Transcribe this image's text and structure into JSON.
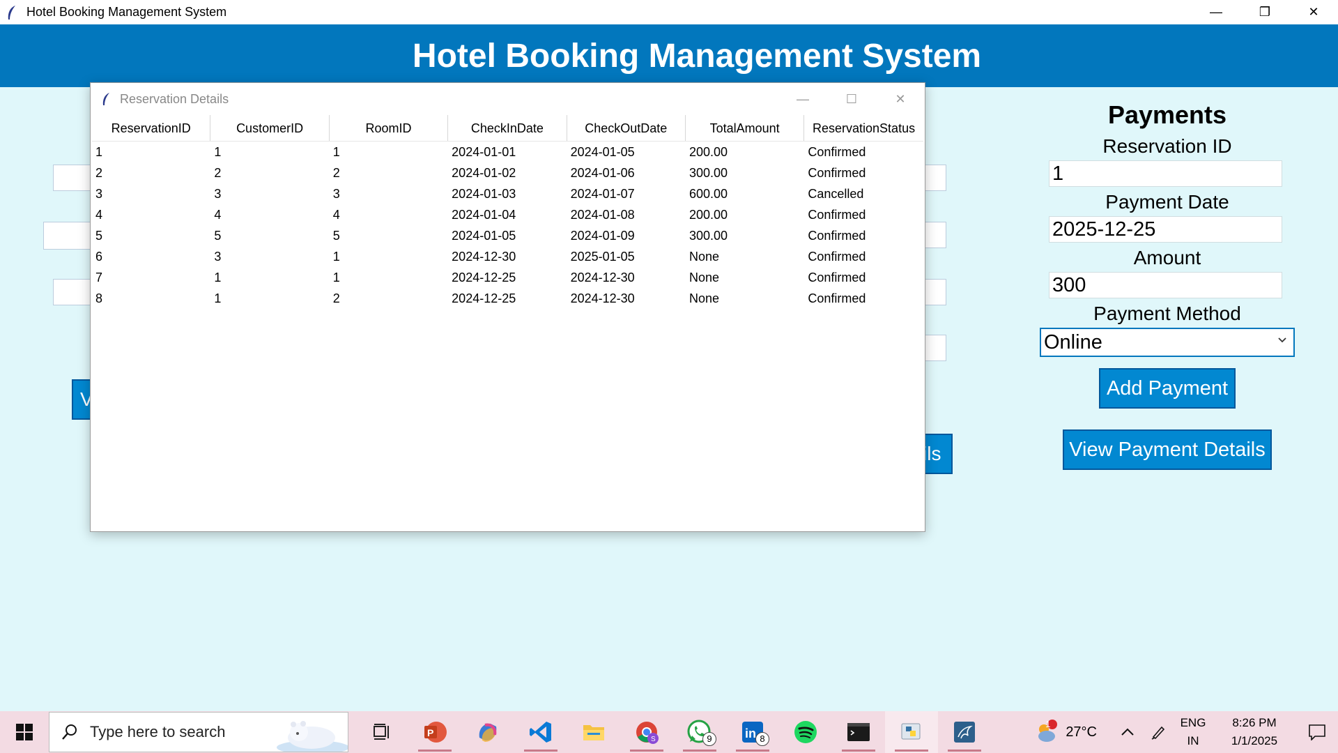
{
  "window": {
    "title": "Hotel Booking Management System",
    "controls": {
      "minimize": "—",
      "restore": "❐",
      "close": "✕"
    }
  },
  "header": {
    "title": "Hotel Booking Management System"
  },
  "background": {
    "partial_button_left": "V",
    "partial_button_right": "ils"
  },
  "payments": {
    "heading": "Payments",
    "reservation_id_label": "Reservation ID",
    "reservation_id_value": "1",
    "payment_date_label": "Payment Date",
    "payment_date_value": "2025-12-25",
    "amount_label": "Amount",
    "amount_value": "300",
    "payment_method_label": "Payment Method",
    "payment_method_value": "Online",
    "add_button": "Add Payment",
    "view_button": "View Payment Details"
  },
  "dialog": {
    "title": "Reservation Details",
    "columns": [
      "ReservationID",
      "CustomerID",
      "RoomID",
      "CheckInDate",
      "CheckOutDate",
      "TotalAmount",
      "ReservationStatus"
    ],
    "rows": [
      [
        "1",
        "1",
        "1",
        "2024-01-01",
        "2024-01-05",
        "200.00",
        "Confirmed"
      ],
      [
        "2",
        "2",
        "2",
        "2024-01-02",
        "2024-01-06",
        "300.00",
        "Confirmed"
      ],
      [
        "3",
        "3",
        "3",
        "2024-01-03",
        "2024-01-07",
        "600.00",
        "Cancelled"
      ],
      [
        "4",
        "4",
        "4",
        "2024-01-04",
        "2024-01-08",
        "200.00",
        "Confirmed"
      ],
      [
        "5",
        "5",
        "5",
        "2024-01-05",
        "2024-01-09",
        "300.00",
        "Confirmed"
      ],
      [
        "6",
        "3",
        "1",
        "2024-12-30",
        "2025-01-05",
        "None",
        "Confirmed"
      ],
      [
        "7",
        "1",
        "1",
        "2024-12-25",
        "2024-12-30",
        "None",
        "Confirmed"
      ],
      [
        "8",
        "1",
        "2",
        "2024-12-25",
        "2024-12-30",
        "None",
        "Confirmed"
      ]
    ]
  },
  "taskbar": {
    "search_placeholder": "Type here to search",
    "whatsapp_badge": "9",
    "linkedin_badge": "8",
    "weather_badge": "1",
    "temperature": "27°C",
    "lang_line1": "ENG",
    "lang_line2": "IN",
    "time": "8:26 PM",
    "date": "1/1/2025"
  },
  "colors": {
    "header": "#0277bd",
    "background": "#e0f7fa",
    "button": "#0288d1",
    "taskbar": "#f3dbe3"
  }
}
